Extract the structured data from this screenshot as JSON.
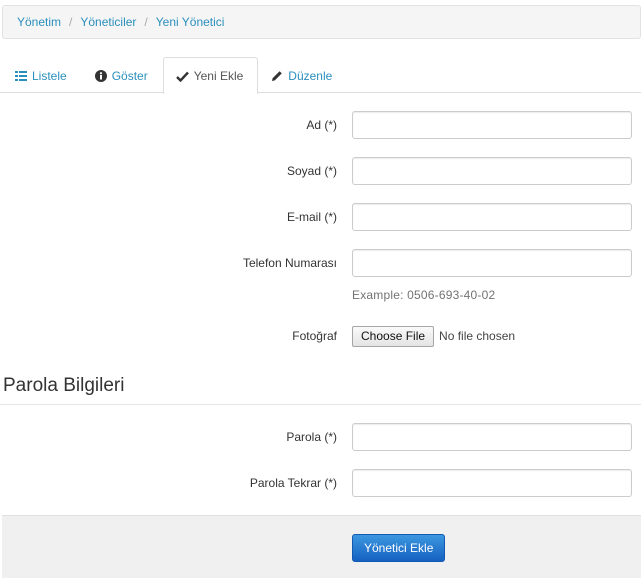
{
  "breadcrumb": [
    "Yönetim",
    "Yöneticiler",
    "Yeni Yönetici"
  ],
  "tabs": [
    {
      "label": "Listele",
      "icon": "list-icon"
    },
    {
      "label": "Göster",
      "icon": "info-icon"
    },
    {
      "label": "Yeni Ekle",
      "icon": "checkmark-icon",
      "active": true
    },
    {
      "label": "Düzenle",
      "icon": "pencil-icon"
    }
  ],
  "form": {
    "ad": {
      "label": "Ad (*)",
      "value": ""
    },
    "soyad": {
      "label": "Soyad (*)",
      "value": ""
    },
    "email": {
      "label": "E-mail (*)",
      "value": ""
    },
    "telefon": {
      "label": "Telefon Numarası",
      "value": "",
      "help": "Example: 0506-693-40-02"
    },
    "fotograf": {
      "label": "Fotoğraf",
      "button": "Choose File",
      "status": "No file chosen"
    }
  },
  "password_section": {
    "title": "Parola Bilgileri",
    "parola": {
      "label": "Parola (*)",
      "value": ""
    },
    "parola_tekrar": {
      "label": "Parola Tekrar (*)",
      "value": ""
    }
  },
  "submit_label": "Yönetici Ekle",
  "colors": {
    "link": "#2a8fbd",
    "primary_button": "#1a6fcf",
    "actions_bg": "#f0f0f0"
  }
}
